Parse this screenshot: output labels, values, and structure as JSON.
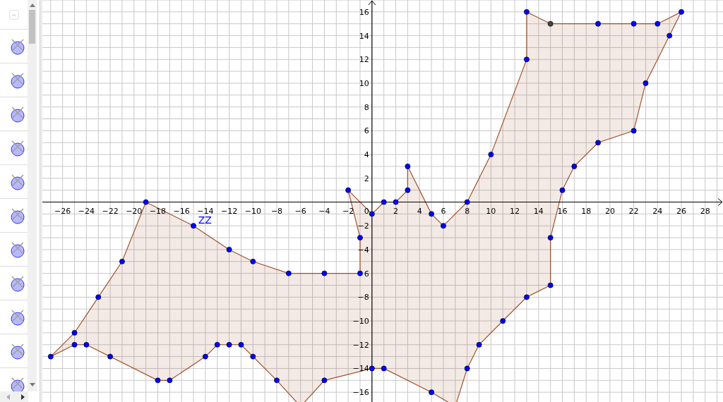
{
  "algebra_view": {
    "collapse_button": "−",
    "items": [
      {
        "kind": "point"
      },
      {
        "kind": "point"
      },
      {
        "kind": "point"
      },
      {
        "kind": "point"
      },
      {
        "kind": "point"
      },
      {
        "kind": "point"
      },
      {
        "kind": "point"
      },
      {
        "kind": "point"
      },
      {
        "kind": "point"
      },
      {
        "kind": "point"
      },
      {
        "kind": "point"
      }
    ]
  },
  "graphics_view": {
    "label": {
      "text": "ZZ"
    },
    "origin_label": "0",
    "chart_data": {
      "type": "scatter",
      "grid": true,
      "xlim": [
        -27.7,
        29.5
      ],
      "ylim": [
        -16.9,
        17
      ],
      "xticks": [
        -26,
        -24,
        -22,
        -20,
        -18,
        -16,
        -14,
        -12,
        -10,
        -8,
        -6,
        -4,
        -2,
        2,
        4,
        6,
        8,
        10,
        12,
        14,
        16,
        18,
        20,
        22,
        24,
        26,
        28
      ],
      "yticks": [
        -16,
        -14,
        -12,
        -10,
        -8,
        {
          "value": -6,
          "label": "6"
        },
        -4,
        -2,
        2,
        4,
        6,
        8,
        10,
        12,
        14,
        16
      ],
      "x": [
        -27,
        -25,
        -23,
        -21,
        -19,
        -15,
        -12,
        -10,
        -7,
        -4,
        -1,
        -1,
        -2,
        0,
        1,
        2,
        3,
        3,
        5,
        6,
        8,
        10,
        13,
        13,
        15,
        19,
        22,
        24,
        26,
        25,
        23,
        22,
        19,
        17,
        16,
        15,
        15,
        13,
        11,
        9,
        8,
        7,
        5,
        1,
        0,
        -4,
        -6,
        -8,
        -10,
        -11,
        -12,
        -13,
        -14,
        -17,
        -18,
        -22,
        -24,
        -25
      ],
      "series": [
        {
          "color": "#0000ff",
          "values": [
            -13,
            -11,
            -8,
            -5,
            0,
            -2,
            -4,
            -5,
            -6,
            -6,
            -6,
            -3,
            1,
            -1,
            0,
            0,
            1,
            3,
            -1,
            -2,
            0,
            4,
            12,
            16,
            null,
            15,
            15,
            15,
            16,
            14,
            10,
            6,
            5,
            3,
            1,
            -3,
            -7,
            -8,
            -10,
            -12,
            -14,
            null,
            -16,
            -14,
            -14,
            -15,
            null,
            -15,
            -13,
            -12,
            -12,
            -12,
            -13,
            -15,
            -15,
            -13,
            -12,
            -12
          ]
        },
        {
          "color": "#444444",
          "values": [
            null,
            null,
            null,
            null,
            null,
            null,
            null,
            null,
            null,
            null,
            null,
            null,
            null,
            null,
            null,
            null,
            null,
            null,
            null,
            null,
            null,
            null,
            null,
            null,
            15,
            null,
            null,
            null,
            null,
            null,
            null,
            null,
            null,
            null,
            null,
            null,
            null,
            null,
            null,
            null,
            null,
            null,
            null,
            null,
            null,
            null,
            null,
            null,
            null,
            null,
            null,
            null,
            null,
            null,
            null,
            null,
            null,
            null
          ]
        }
      ]
    }
  }
}
